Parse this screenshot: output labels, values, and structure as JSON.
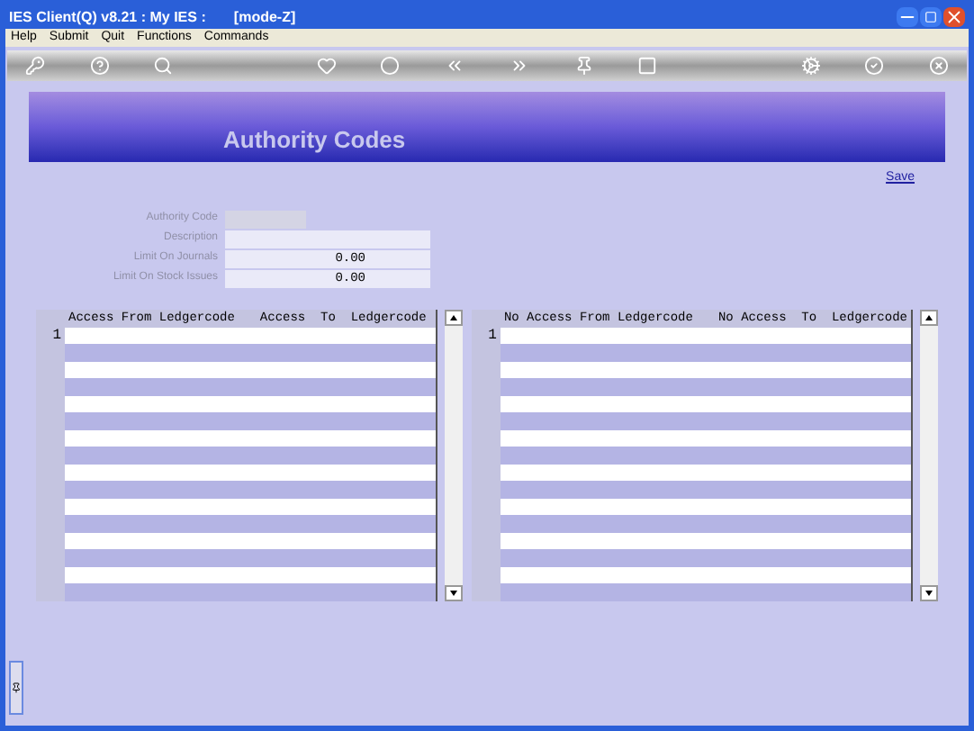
{
  "window": {
    "title": "IES Client(Q) v8.21 : My IES :       [mode-Z]"
  },
  "menu": [
    "Help",
    "Submit",
    "Quit",
    "Functions",
    "Commands"
  ],
  "banner": {
    "title": "Authority Codes"
  },
  "save_link": "Save",
  "fields": [
    {
      "label": "Authority Code",
      "kind": "short"
    },
    {
      "label": "Description",
      "kind": "wide"
    },
    {
      "label": "Limit On Journals",
      "value": "0.00",
      "kind": "wide"
    },
    {
      "label": "Limit On Stock Issues",
      "value": "0.00",
      "kind": "wide"
    }
  ],
  "grids": [
    {
      "columns": [
        "Access From Ledgercode",
        "Access  To  Ledgercode"
      ],
      "row_numbers": [
        "1"
      ]
    },
    {
      "columns": [
        "No Access From Ledgercode",
        "No Access  To  Ledgercode"
      ],
      "row_numbers": [
        "1"
      ]
    }
  ]
}
